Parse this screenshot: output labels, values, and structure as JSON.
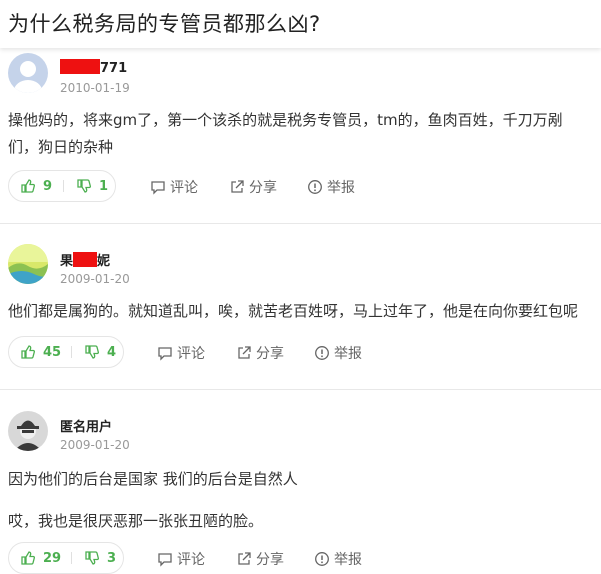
{
  "page": {
    "title": "为什么税务局的专管员都那么凶?"
  },
  "answers": [
    {
      "user": {
        "prefix": "",
        "suffix": "771",
        "avatar": "default-avatar"
      },
      "date": "2010-01-19",
      "content": [
        "操他妈的，将来gm了，第一个该杀的就是税务专管员，tm的，鱼肉百姓，千刀万剐",
        "们，狗日的杂种"
      ],
      "up": "9",
      "down": "1",
      "comment": "评论",
      "share": "分享",
      "report": "举报"
    },
    {
      "user": {
        "prefix": "果",
        "suffix": "妮",
        "avatar": "landscape-avatar"
      },
      "date": "2009-01-20",
      "content": [
        "他们都是属狗的。就知道乱叫，唉，就苦老百姓呀，马上过年了，他是在向你要红包呢"
      ],
      "up": "45",
      "down": "4",
      "comment": "评论",
      "share": "分享",
      "report": "举报"
    },
    {
      "user": {
        "prefix": "匿名用户",
        "suffix": "",
        "avatar": "anonymous-avatar"
      },
      "date": "2009-01-20",
      "content": [
        "因为他们的后台是国家 我们的后台是自然人",
        "哎，我也是很厌恶那一张张丑陋的脸。"
      ],
      "up": "29",
      "down": "3",
      "comment": "评论",
      "share": "分享",
      "report": "举报"
    }
  ],
  "colors": {
    "vote": "#4caf50",
    "meta": "#999999",
    "redaction": "#ee1111"
  }
}
